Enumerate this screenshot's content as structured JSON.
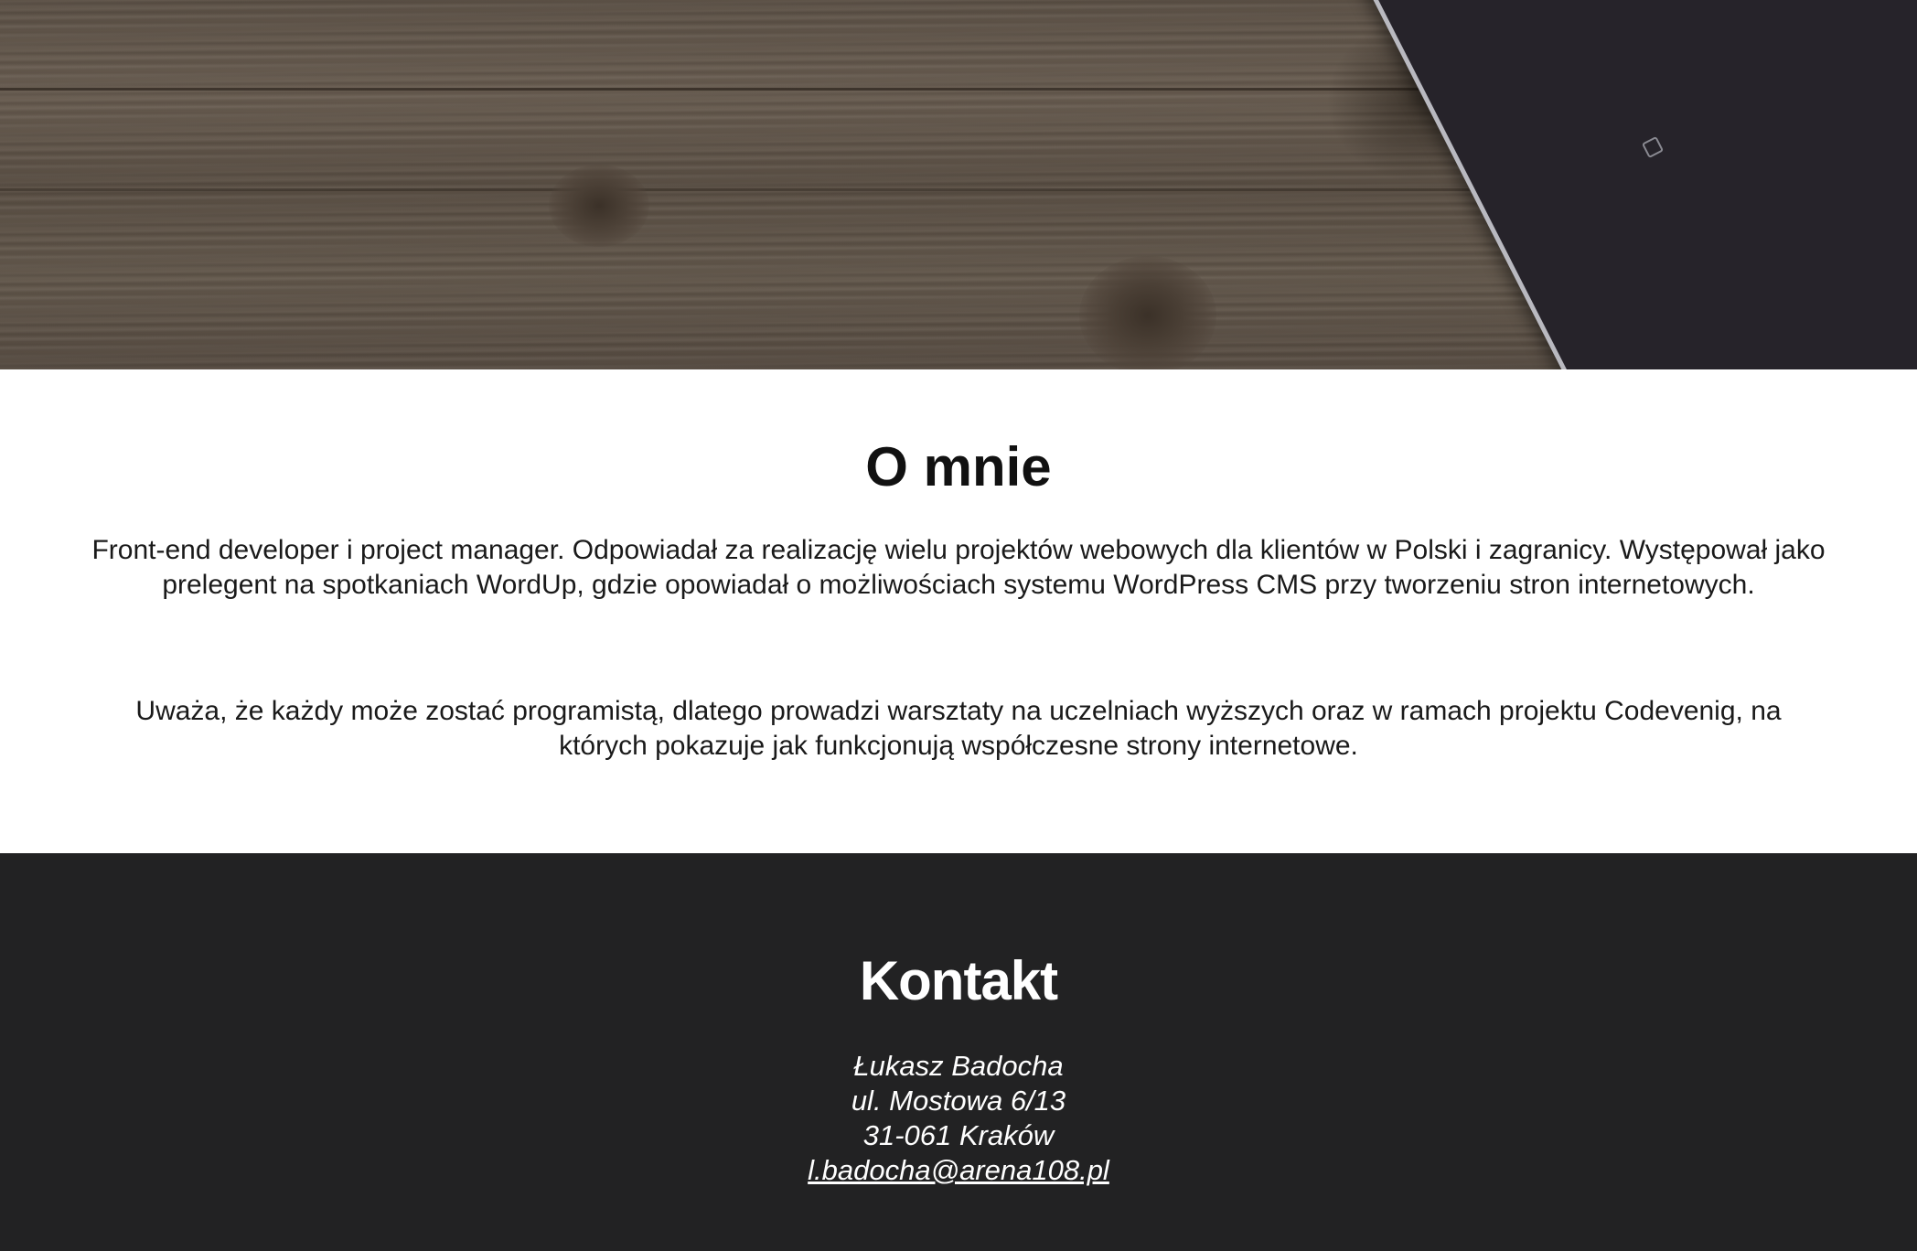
{
  "about": {
    "title": "O mnie",
    "paragraph1": "Front-end developer i project manager. Odpowiadał za realizację wielu projektów webowych dla klientów w Polski i zagranicy. Występował jako prelegent na spotkaniach WordUp, gdzie opowiadał o możliwościach systemu WordPress CMS przy tworzeniu stron internetowych.",
    "paragraph2": "Uważa, że każdy może zostać programistą, dlatego prowadzi warsztaty na uczelniach wyższych oraz w ramach projektu Codevenig, na których pokazuje jak funkcjonują współczesne strony internetowe."
  },
  "contact": {
    "title": "Kontakt",
    "name": "Łukasz Badocha",
    "street": "ul. Mostowa 6/13",
    "city": "31-061 Kraków",
    "email": "l.badocha@arena108.pl"
  },
  "colors": {
    "contact_background": "#222223",
    "about_background": "#ffffff",
    "text_dark": "#111111",
    "text_light": "#ffffff"
  }
}
